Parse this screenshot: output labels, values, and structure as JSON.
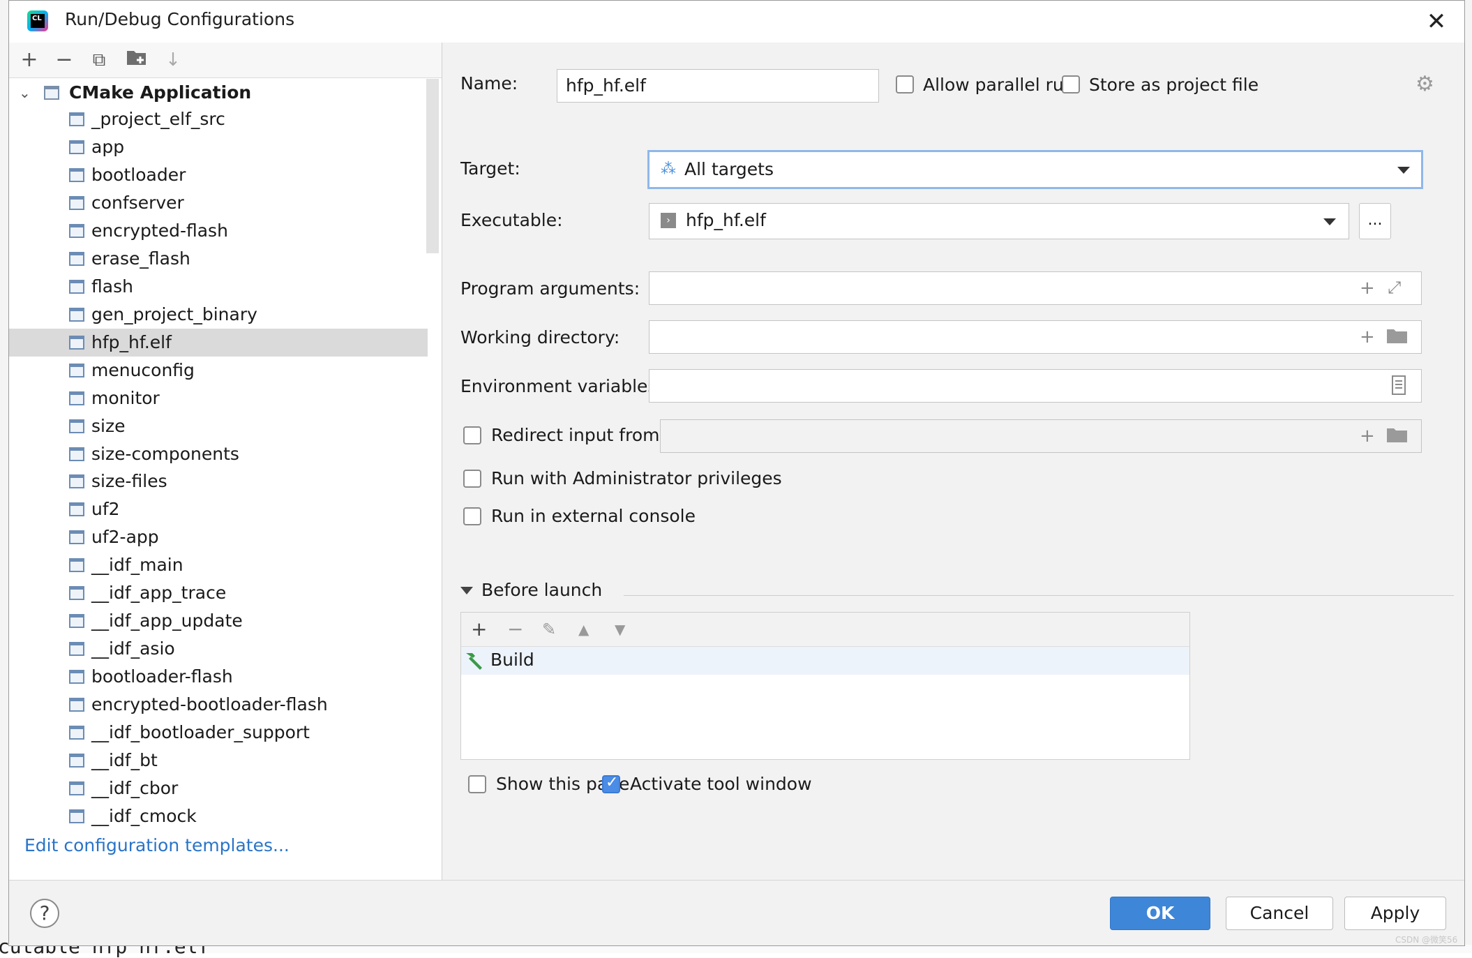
{
  "window": {
    "title": "Run/Debug Configurations",
    "close_glyph": "✕"
  },
  "left_toolbar": {
    "add": "+",
    "remove": "−",
    "copy": "⧉",
    "folder": "📁",
    "sort": "↓"
  },
  "tree": {
    "root": "CMake Application",
    "items": [
      "_project_elf_src",
      "app",
      "bootloader",
      "confserver",
      "encrypted-flash",
      "erase_flash",
      "flash",
      "gen_project_binary",
      "hfp_hf.elf",
      "menuconfig",
      "monitor",
      "size",
      "size-components",
      "size-files",
      "uf2",
      "uf2-app",
      "__idf_main",
      "__idf_app_trace",
      "__idf_app_update",
      "__idf_asio",
      "bootloader-flash",
      "encrypted-bootloader-flash",
      "__idf_bootloader_support",
      "__idf_bt",
      "__idf_cbor",
      "__idf_cmock"
    ],
    "selected": "hfp_hf.elf",
    "edit_templates_link": "Edit configuration templates..."
  },
  "form": {
    "name_label": "Name:",
    "name_value": "hfp_hf.elf",
    "allow_parallel_label": "Allow parallel run",
    "store_project_label": "Store as project file",
    "target_label": "Target:",
    "target_value": "All targets",
    "executable_label": "Executable:",
    "executable_value": "hfp_hf.elf",
    "browse_label": "...",
    "program_args_label": "Program arguments:",
    "working_dir_label": "Working directory:",
    "env_vars_label": "Environment variables:",
    "redirect_label": "Redirect input from:",
    "admin_label": "Run with Administrator privileges",
    "external_console_label": "Run in external console"
  },
  "before_launch": {
    "title": "Before launch",
    "tasks": [
      "Build"
    ],
    "show_page_label": "Show this page",
    "activate_tool_label": "Activate tool window",
    "activate_tool_checked": true,
    "show_page_checked": false
  },
  "footer": {
    "help": "?",
    "ok": "OK",
    "cancel": "Cancel",
    "apply": "Apply"
  },
  "background": {
    "code_snippet": "ecutable hfp hf.elf",
    "watermark": "CSDN @微笑56"
  },
  "colors": {
    "accent": "#3e86d7",
    "link": "#2a74c8",
    "selection": "#dadada"
  }
}
